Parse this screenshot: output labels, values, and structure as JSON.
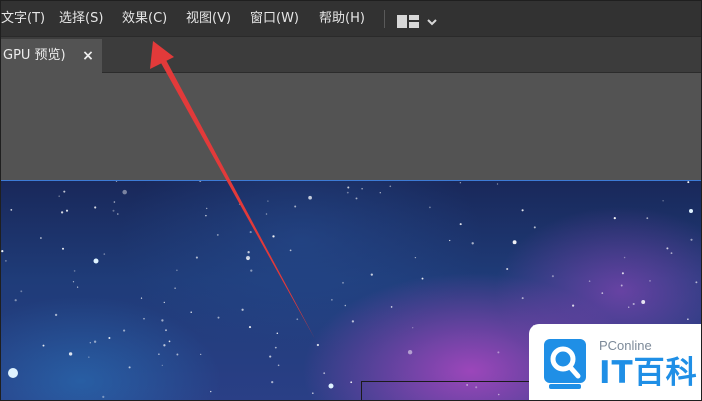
{
  "menubar": {
    "items": [
      {
        "label": "文字(T)"
      },
      {
        "label": "选择(S)"
      },
      {
        "label": "效果(C)"
      },
      {
        "label": "视图(V)"
      },
      {
        "label": "窗口(W)"
      },
      {
        "label": "帮助(H)"
      }
    ],
    "layout_icon": "workspace-layout-icon",
    "chevron_icon": "chevron-down-icon"
  },
  "tabbar": {
    "tab_label": "GPU 预览)",
    "close_glyph": "×"
  },
  "watermark": {
    "site": "PConline",
    "brand": "IT百科"
  },
  "colors": {
    "menubar_bg": "#323232",
    "tabbar_bg": "#3c3c3c",
    "pasteboard": "#535353",
    "annotation_arrow": "#e23a3a",
    "canvas_border": "#3d7bd6",
    "watermark_blue": "#1f8fe6"
  }
}
